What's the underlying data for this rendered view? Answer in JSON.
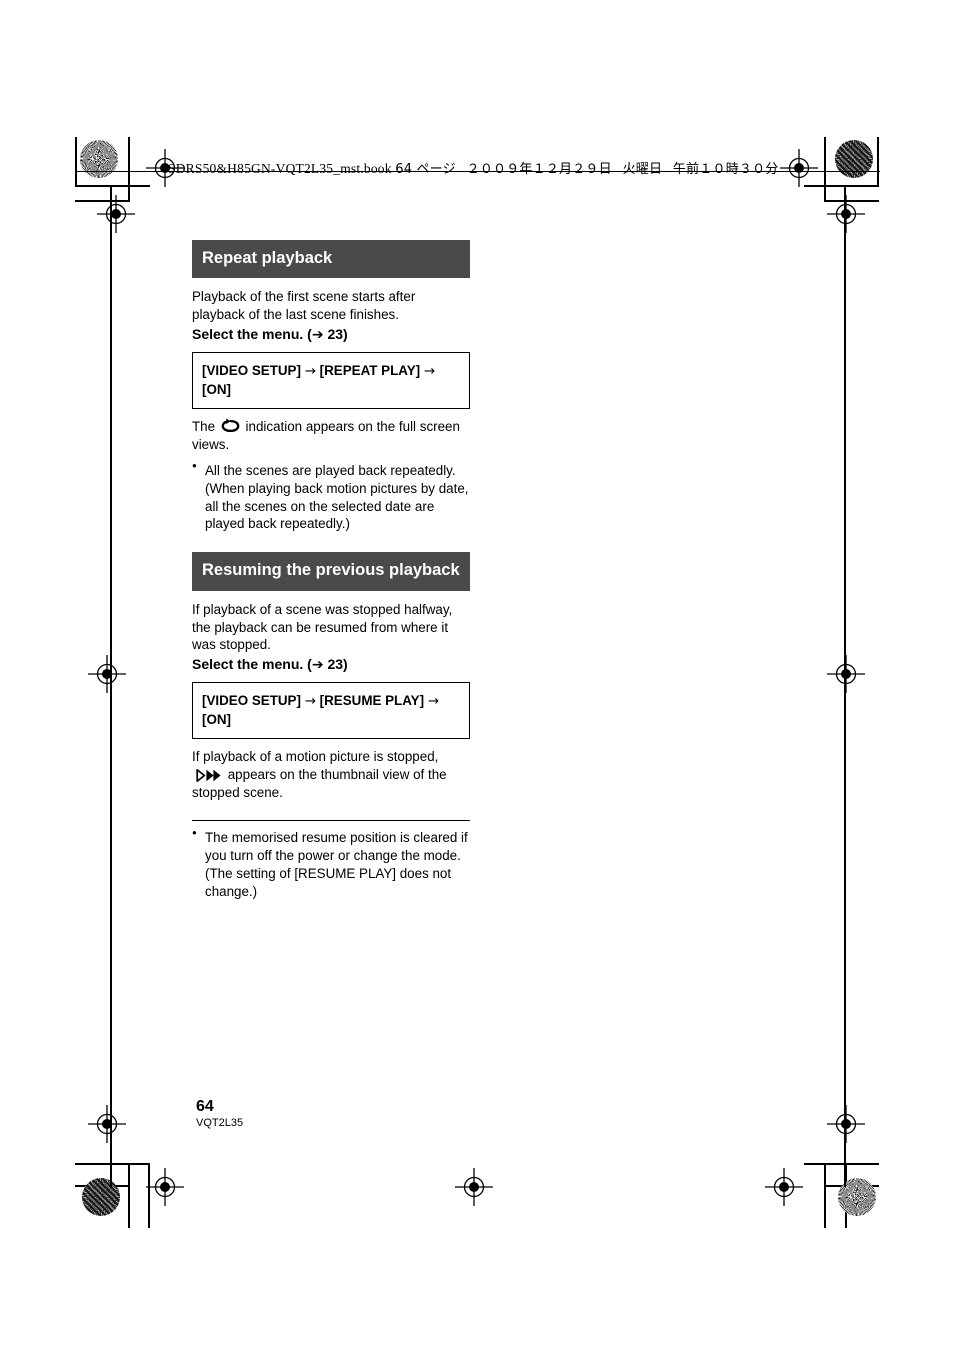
{
  "header": {
    "filename": "SDRS50&H85GN-VQT2L35_mst.book",
    "page_label": "64 ページ",
    "date": "２００９年１２月２９日",
    "weekday": "火曜日",
    "time": "午前１０時３０分"
  },
  "sections": [
    {
      "title": "Repeat playback",
      "intro": "Playback of the first scene starts after playback of the last scene finishes.",
      "select_menu": "Select the menu. (",
      "select_menu_arrow": "➔",
      "select_menu_page": "23)",
      "menu_box": {
        "item1": "[VIDEO SETUP]",
        "arrow1": "→",
        "item2": "[REPEAT PLAY]",
        "arrow2": "→",
        "item3": "[ON]"
      },
      "note_before_icon": "The",
      "note_icon": "repeat-loop-icon",
      "note_after_icon": "indication appears on the full screen views.",
      "bullets": [
        "All the scenes are played back repeatedly. (When playing back motion pictures by date, all the scenes on the selected date are played back repeatedly.)"
      ]
    },
    {
      "title": "Resuming the previous playback",
      "intro": "If playback of a scene was stopped halfway, the playback can be resumed from where it was stopped.",
      "select_menu": "Select the menu. (",
      "select_menu_arrow": "➔",
      "select_menu_page": "23)",
      "menu_box": {
        "item1": "[VIDEO SETUP]",
        "arrow1": "→",
        "item2": "[RESUME PLAY]",
        "arrow2": "→",
        "item3": "[ON]"
      },
      "note_before_icon": "If playback of a motion picture is stopped,",
      "note_icon": "resume-play-icon",
      "note_after_icon": "appears on the thumbnail view of the stopped scene.",
      "bullets": [
        "The memorised resume position is cleared if you turn off the power or change the mode. (The setting of [RESUME PLAY] does not change.)"
      ]
    }
  ],
  "footer": {
    "page_number": "64",
    "doc_code": "VQT2L35"
  },
  "colors": {
    "section_bar_bg": "#4a4a4a",
    "section_bar_text": "#ffffff",
    "text": "#000000",
    "page_bg": "#ffffff"
  },
  "print_marks": {
    "corner_starburst": "registration-starburst",
    "corner_target": "registration-target"
  }
}
